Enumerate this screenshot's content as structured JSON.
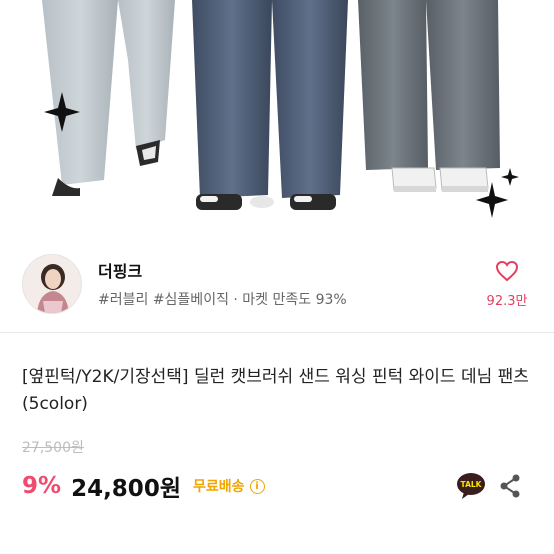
{
  "product_image": {
    "alt": "denim pants product photo"
  },
  "shop": {
    "name": "더핑크",
    "tags": "#러블리 #심플베이직 · 마켓 만족도 93%",
    "likes": "92.3만"
  },
  "product": {
    "title": "[옆핀턱/Y2K/기장선택] 딜런 캣브러쉬 샌드 워싱 핀턱 와이드 데님 팬츠 (5color)",
    "original_price": "27,500원",
    "discount": "9%",
    "price": "24,800원",
    "shipping": "무료배송"
  },
  "icons": {
    "like": "heart-outline-icon",
    "info": "info-circle-icon",
    "talk": "kakaotalk-icon",
    "share": "share-icon"
  },
  "colors": {
    "accent_pink": "#f04a6e",
    "shipping_yellow": "#f0a500",
    "kakao_talk": "#3a1d1d"
  }
}
